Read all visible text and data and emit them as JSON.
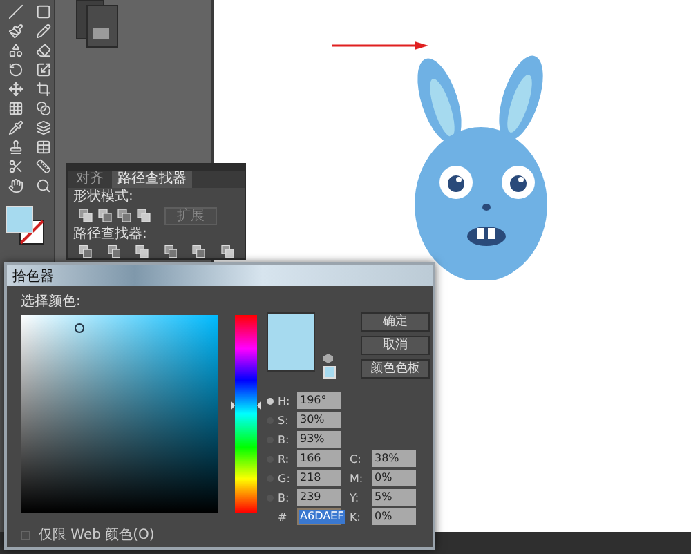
{
  "pathfinder_panel": {
    "tabs": [
      {
        "label": "对齐",
        "selected": false
      },
      {
        "label": "路径查找器",
        "selected": true
      }
    ],
    "shape_modes_label": "形状模式:",
    "expand_button": "扩展",
    "pathfinders_label": "路径查找器:"
  },
  "color_picker": {
    "title": "拾色器",
    "prompt": "选择颜色:",
    "buttons": [
      "确定",
      "取消",
      "颜色色板"
    ],
    "fields": [
      {
        "label": "H:",
        "value": "196°",
        "selected": true
      },
      {
        "label": "S:",
        "value": "30%",
        "selected": false
      },
      {
        "label": "B:",
        "value": "93%",
        "selected": false
      },
      {
        "label": "R:",
        "value": "166",
        "selected": false
      },
      {
        "label": "G:",
        "value": "218",
        "selected": false
      },
      {
        "label": "B:",
        "value": "239",
        "selected": false
      }
    ],
    "cmyk_fields": [
      {
        "label": "C:",
        "value": "38%"
      },
      {
        "label": "M:",
        "value": "0%"
      },
      {
        "label": "Y:",
        "value": "5%"
      },
      {
        "label": "K:",
        "value": "0%"
      }
    ],
    "hex": {
      "label": "#",
      "value": "A6DAEF"
    },
    "web_only": {
      "label": "仅限 Web 颜色(O)",
      "checked": false
    }
  }
}
